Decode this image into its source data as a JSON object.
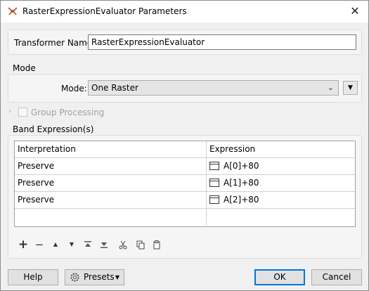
{
  "window": {
    "title": "RasterExpressionEvaluator Parameters",
    "close_glyph": "✕"
  },
  "transformer": {
    "label": "Transformer Name:",
    "value": "RasterExpressionEvaluator"
  },
  "mode_section": {
    "title": "Mode",
    "mode_label": "Mode:",
    "mode_value": "One Raster"
  },
  "group_processing": {
    "label": "Group Processing",
    "checked": false,
    "enabled": false
  },
  "band_expressions": {
    "title": "Band Expression(s)",
    "columns": [
      "Interpretation",
      "Expression"
    ],
    "rows": [
      {
        "interpretation": "Preserve",
        "expression": "A[0]+80"
      },
      {
        "interpretation": "Preserve",
        "expression": "A[1]+80"
      },
      {
        "interpretation": "Preserve",
        "expression": "A[2]+80"
      }
    ]
  },
  "toolbar_icons": [
    "add-icon",
    "remove-icon",
    "move-up-icon",
    "move-down-icon",
    "move-top-icon",
    "move-bottom-icon",
    "cut-icon",
    "copy-icon",
    "paste-icon"
  ],
  "buttons": {
    "help": "Help",
    "presets": "Presets",
    "ok": "OK",
    "cancel": "Cancel"
  }
}
